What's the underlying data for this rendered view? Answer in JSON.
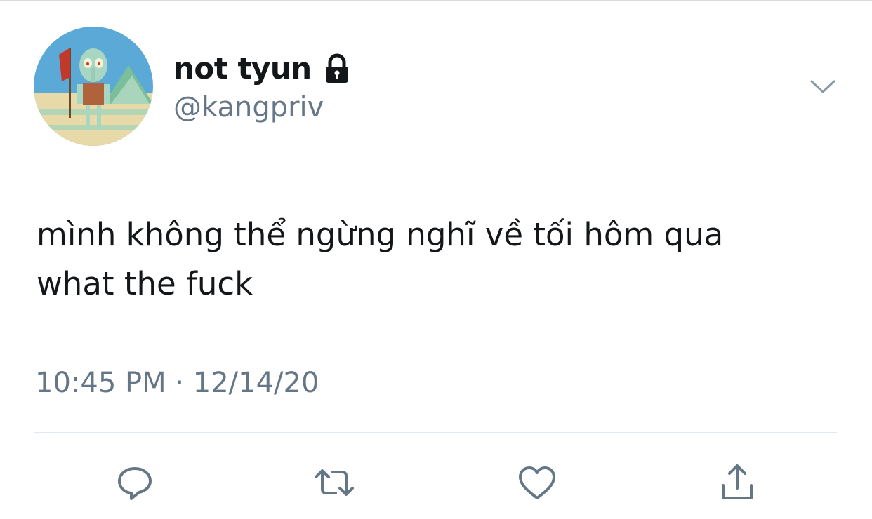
{
  "tweet": {
    "display_name": "not tyun",
    "handle": "@kangpriv",
    "text_lines": [
      "mình không thể ngừng nghĩ về tối hôm qua",
      "what the fuck"
    ],
    "time": "10:45 PM",
    "separator": "·",
    "date": "12/14/20",
    "protected": true
  },
  "icons": {
    "lock": "lock-icon",
    "menu": "chevron-down-icon",
    "reply": "reply-icon",
    "retweet": "retweet-icon",
    "like": "heart-icon",
    "share": "share-icon",
    "avatar": "squidward-avatar"
  },
  "colors": {
    "text": "#14171a",
    "secondary": "#657786",
    "icon": "#657786",
    "divider": "#e1e8ed"
  }
}
